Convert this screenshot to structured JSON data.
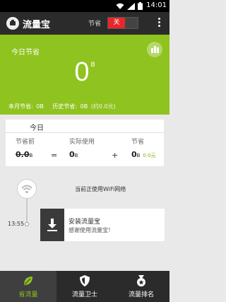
{
  "status_bar": {
    "time": "14:01"
  },
  "app_bar": {
    "title": "流量宝",
    "toggle_label": "节省",
    "toggle_state": "关"
  },
  "banner": {
    "title": "今日节省",
    "value": "0",
    "unit": "B",
    "month_label": "本月节省:",
    "month_value": "0B",
    "history_label": "历史节省:",
    "history_value": "0B",
    "history_approx": "(约0.0元)"
  },
  "today": {
    "title": "今日",
    "before_label": "节省前",
    "before_value": "0.0",
    "before_unit": "B",
    "equals": "=",
    "actual_label": "实际使用",
    "actual_value": "0",
    "actual_unit": "B",
    "plus": "+",
    "saved_label": "节省",
    "saved_value": "0",
    "saved_unit": "B",
    "saved_money": "0.0元"
  },
  "timeline": {
    "wifi_text": "当前正使用WiFi网络",
    "time": "13:55",
    "install_title": "安装流量宝",
    "install_sub": "感谢使用流量宝！"
  },
  "nav": {
    "items": [
      {
        "label": "省流量"
      },
      {
        "label": "流量卫士"
      },
      {
        "label": "流量排名"
      }
    ]
  },
  "colors": {
    "accent": "#8fc31f",
    "toggle_off": "#e5282b",
    "dark_bar": "#2b2b2b"
  }
}
